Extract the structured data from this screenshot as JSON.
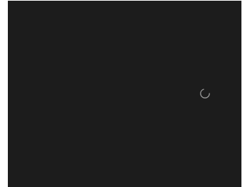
{
  "app": {
    "background_color": "#1c1c1c",
    "frame_color": "#ffffff"
  },
  "loading": {
    "icon": "loading-spinner-icon",
    "color": "#9a9a9a"
  }
}
